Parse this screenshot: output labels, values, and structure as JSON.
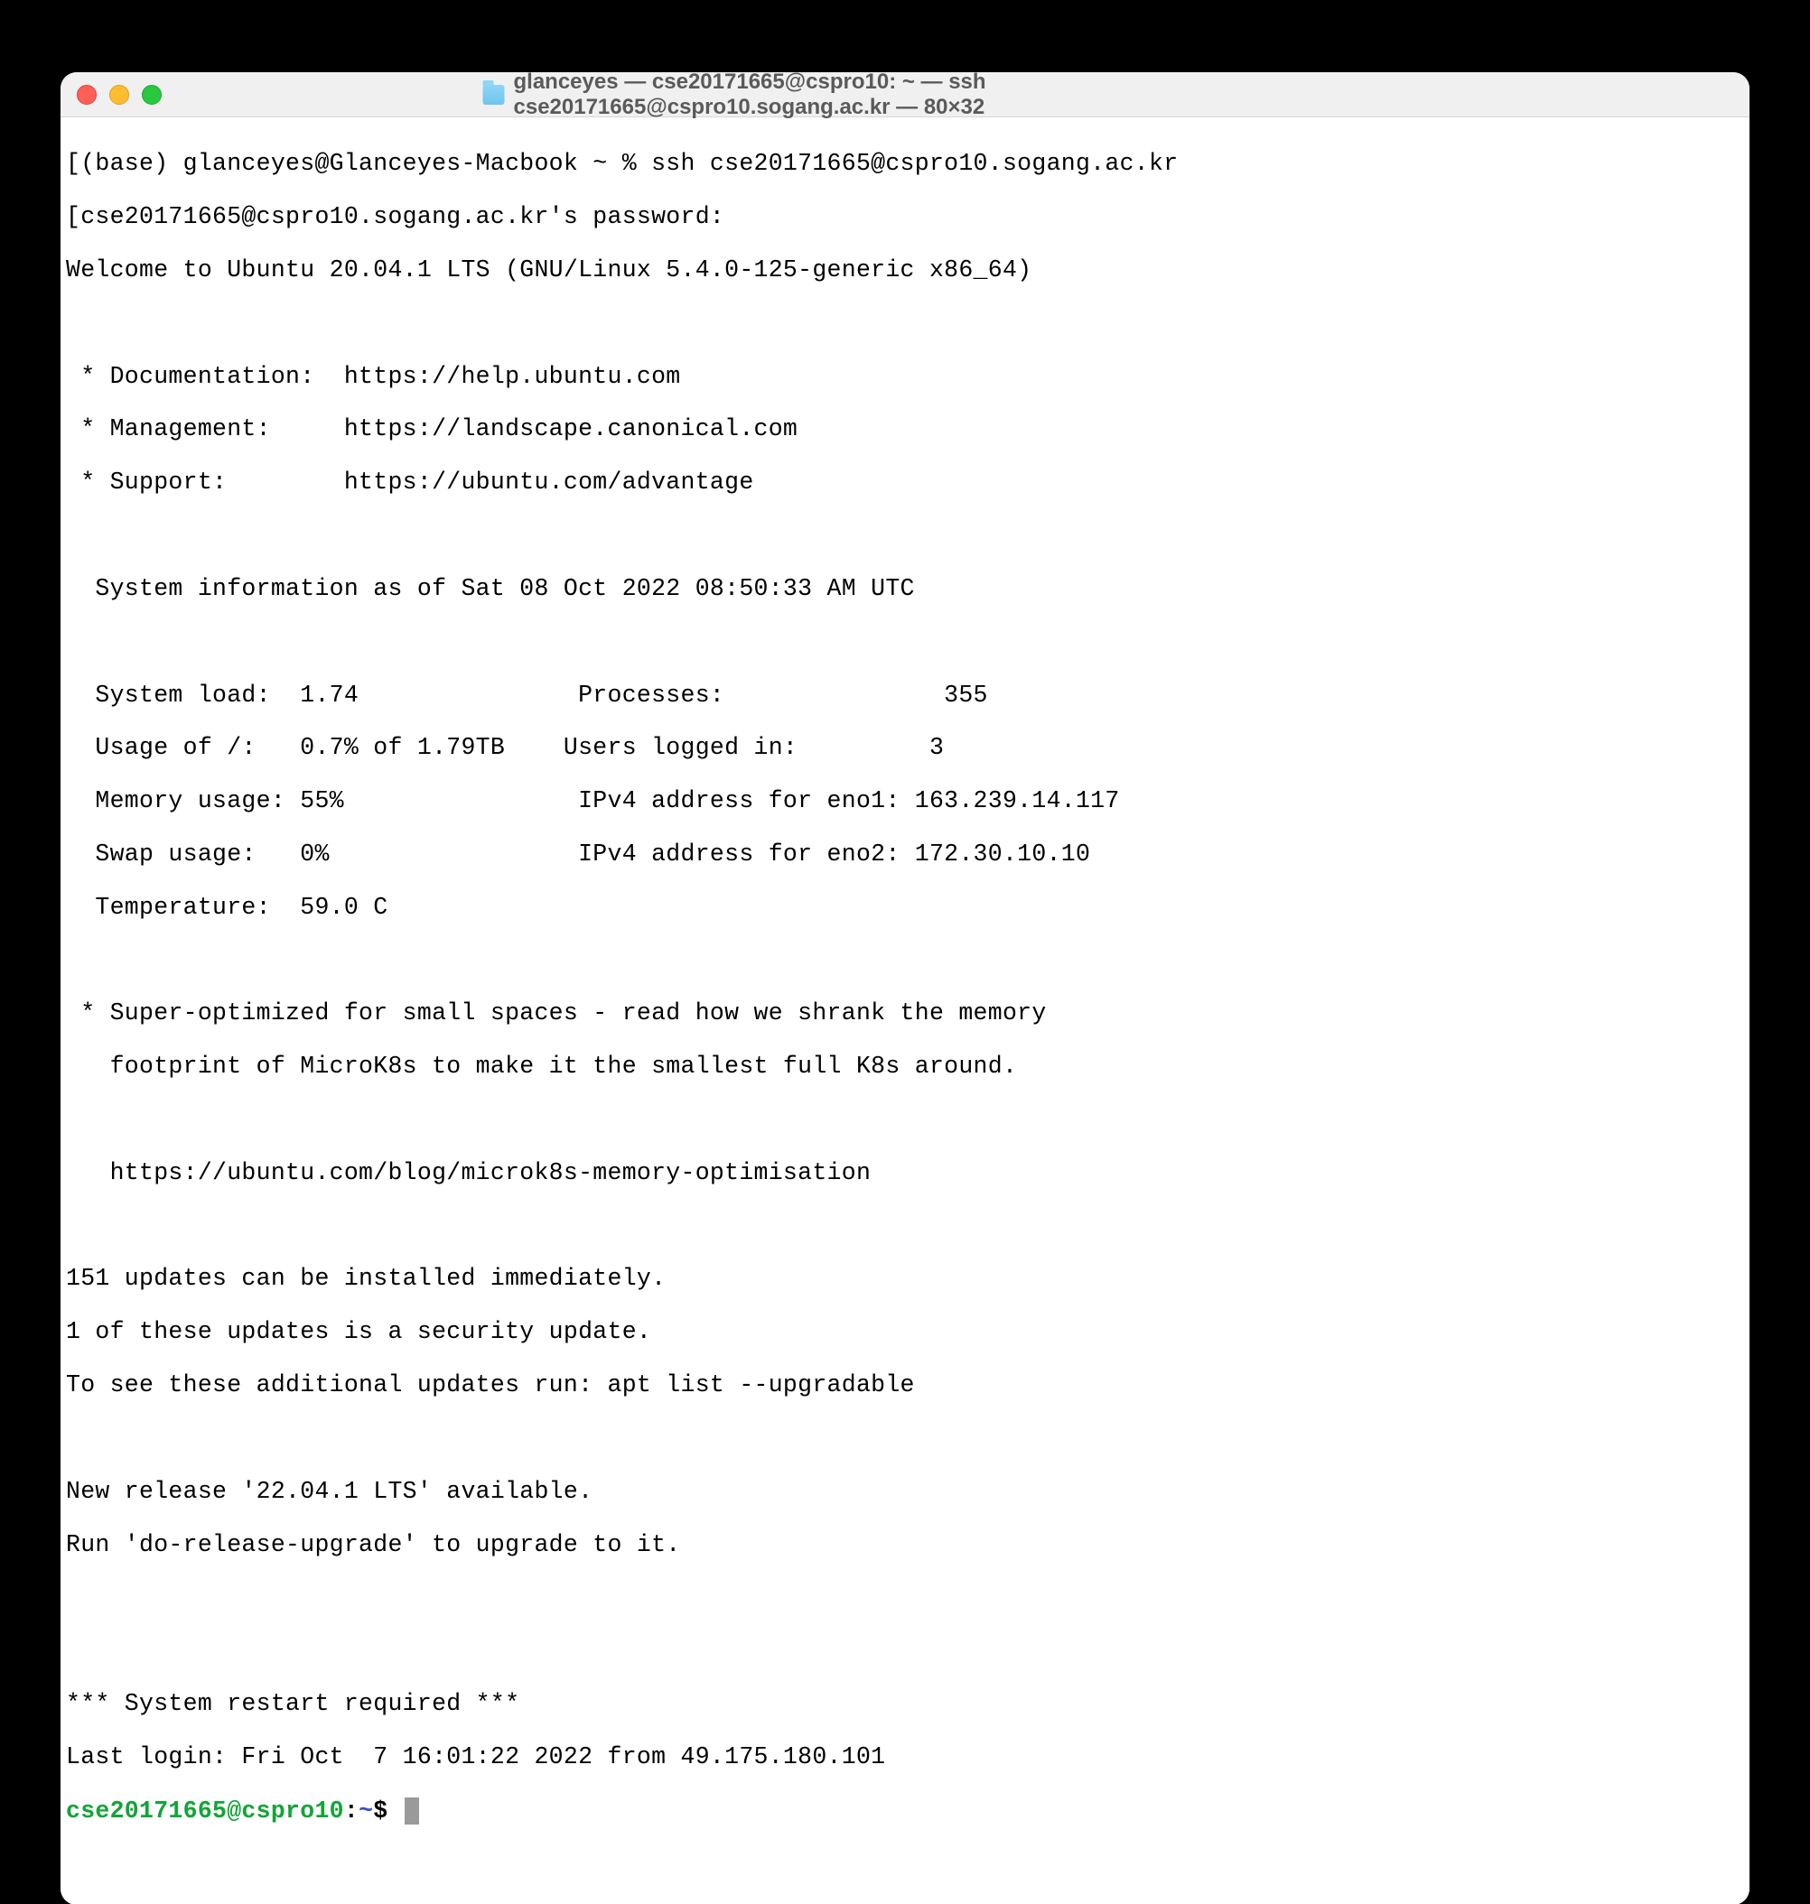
{
  "titlebar": {
    "title": "glanceyes — cse20171665@cspro10: ~ — ssh cse20171665@cspro10.sogang.ac.kr — 80×32"
  },
  "lines": {
    "l0": "[(base) glanceyes@Glanceyes-Macbook ~ % ssh cse20171665@cspro10.sogang.ac.kr",
    "l1": "[cse20171665@cspro10.sogang.ac.kr's password:",
    "l2": "Welcome to Ubuntu 20.04.1 LTS (GNU/Linux 5.4.0-125-generic x86_64)",
    "l3": "",
    "l4": " * Documentation:  https://help.ubuntu.com",
    "l5": " * Management:     https://landscape.canonical.com",
    "l6": " * Support:        https://ubuntu.com/advantage",
    "l7": "",
    "l8": "  System information as of Sat 08 Oct 2022 08:50:33 AM UTC",
    "l9": "",
    "l10": "  System load:  1.74               Processes:               355",
    "l11": "  Usage of /:   0.7% of 1.79TB    Users logged in:         3",
    "l12": "  Memory usage: 55%                IPv4 address for eno1: 163.239.14.117",
    "l13": "  Swap usage:   0%                 IPv4 address for eno2: 172.30.10.10",
    "l14": "  Temperature:  59.0 C",
    "l15": "",
    "l16": " * Super-optimized for small spaces - read how we shrank the memory",
    "l17": "   footprint of MicroK8s to make it the smallest full K8s around.",
    "l18": "",
    "l19": "   https://ubuntu.com/blog/microk8s-memory-optimisation",
    "l20": "",
    "l21": "151 updates can be installed immediately.",
    "l22": "1 of these updates is a security update.",
    "l23": "To see these additional updates run: apt list --upgradable",
    "l24": "",
    "l25": "New release '22.04.1 LTS' available.",
    "l26": "Run 'do-release-upgrade' to upgrade to it.",
    "l27": "",
    "l28": "",
    "l29": "*** System restart required ***",
    "l30": "Last login: Fri Oct  7 16:01:22 2022 from 49.175.180.101"
  },
  "prompt": {
    "user": "cse20171665@cspro10",
    "colon": ":",
    "path": "~",
    "dollar": "$ "
  }
}
